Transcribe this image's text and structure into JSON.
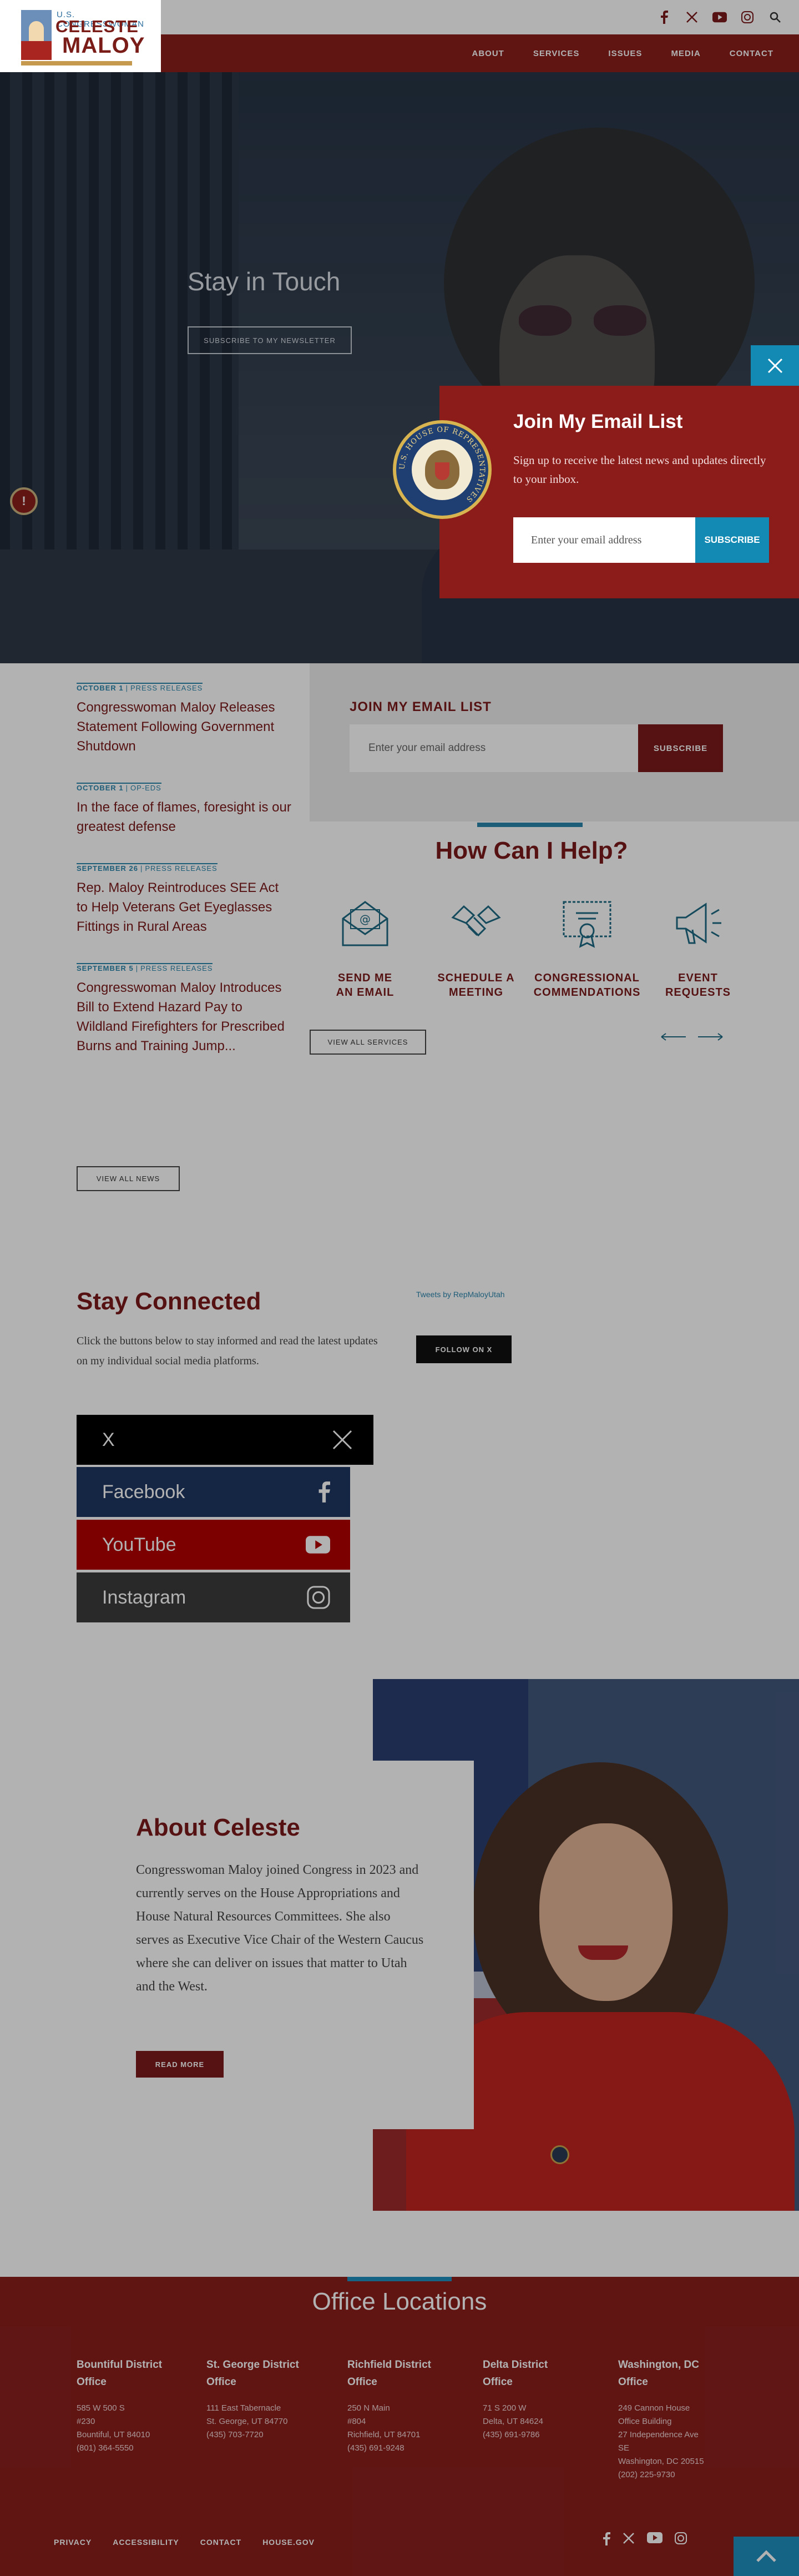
{
  "header": {
    "logo_top": "U.S. CONGRESSWOMAN",
    "logo_name_first": "CELESTE",
    "logo_name_last": "MALOY",
    "social": [
      "facebook-icon",
      "x-icon",
      "youtube-icon",
      "instagram-icon",
      "search-icon"
    ],
    "nav": [
      "ABOUT",
      "SERVICES",
      "ISSUES",
      "MEDIA",
      "CONTACT"
    ]
  },
  "hero": {
    "title": "Stay in Touch",
    "button": "SUBSCRIBE TO MY NEWSLETTER"
  },
  "popup": {
    "title": "Join My Email List",
    "subtitle": "Sign up to receive the latest news and updates directly to your inbox.",
    "input_placeholder": "Enter your email address",
    "button": "SUBSCRIBE",
    "seal_text": "U.S. HOUSE OF REPRESENTATIVES"
  },
  "news": {
    "items": [
      {
        "date": "OCTOBER 1",
        "category": "PRESS RELEASES",
        "title": "Congresswoman Maloy Releases Statement Following Government Shutdown"
      },
      {
        "date": "OCTOBER 1",
        "category": "OP-EDS",
        "title": "In the face of flames, foresight is our greatest defense"
      },
      {
        "date": "SEPTEMBER 26",
        "category": "PRESS RELEASES",
        "title": "Rep. Maloy Reintroduces SEE Act to Help Veterans Get Eyeglasses Fittings in Rural Areas"
      },
      {
        "date": "SEPTEMBER 5",
        "category": "PRESS RELEASES",
        "title": "Congresswoman Maloy Introduces Bill to Extend Hazard Pay to Wildland Firefighters for Prescribed Burns and Training Jump..."
      }
    ],
    "button": "VIEW ALL NEWS"
  },
  "signup": {
    "title": "JOIN MY EMAIL LIST",
    "input_placeholder": "Enter your email address",
    "button": "SUBSCRIBE"
  },
  "help": {
    "title": "How Can I Help?",
    "services": [
      {
        "label_line1": "SEND ME",
        "label_line2": "AN EMAIL",
        "icon": "envelope-icon"
      },
      {
        "label_line1": "SCHEDULE A",
        "label_line2": "MEETING",
        "icon": "handshake-icon"
      },
      {
        "label_line1": "CONGRESSIONAL",
        "label_line2": "COMMENDATIONS",
        "icon": "certificate-icon"
      },
      {
        "label_line1": "EVENT",
        "label_line2": "REQUESTS",
        "icon": "megaphone-icon"
      }
    ],
    "button": "VIEW ALL SERVICES"
  },
  "connect": {
    "title": "Stay Connected",
    "text": "Click the buttons below to stay informed and read the latest updates on my individual social media platforms.",
    "buttons": [
      {
        "label": "X",
        "color": "#000000"
      },
      {
        "label": "Facebook",
        "color": "#1f3764"
      },
      {
        "label": "YouTube",
        "color": "#b30000"
      },
      {
        "label": "Instagram",
        "color": "#3c3c3c"
      }
    ],
    "tweets_link": "Tweets by RepMaloyUtah",
    "follow_button": "FOLLOW ON X"
  },
  "about": {
    "title": "About Celeste",
    "text": "Congresswoman Maloy joined Congress in 2023 and currently serves on the House Appropriations and House Natural Resources Committees. She also serves as Executive Vice Chair of the Western Caucus where she can deliver on issues that matter to Utah and the West.",
    "button": "READ MORE"
  },
  "footer": {
    "title": "Office Locations",
    "offices": [
      {
        "name_1": "Bountiful District",
        "name_2": "Office",
        "lines": [
          "585 W 500 S",
          "#230",
          "Bountiful, UT 84010",
          "(801) 364-5550"
        ]
      },
      {
        "name_1": "St. George District",
        "name_2": "Office",
        "lines": [
          "111 East Tabernacle",
          "St. George, UT 84770",
          "(435) 703-7720"
        ]
      },
      {
        "name_1": "Richfield District",
        "name_2": "Office",
        "lines": [
          "250 N Main",
          "#804",
          "Richfield, UT 84701",
          "(435) 691-9248"
        ]
      },
      {
        "name_1": "Delta District",
        "name_2": "Office",
        "lines": [
          "71 S 200 W",
          "Delta, UT 84624",
          "(435) 691-9786"
        ]
      },
      {
        "name_1": "Washington, DC",
        "name_2": "Office",
        "lines": [
          "249 Cannon House",
          "Office Building",
          "27 Independence Ave",
          "SE",
          "Washington, DC 20515",
          "(202) 225-9730"
        ]
      }
    ],
    "links": [
      "PRIVACY",
      "ACCESSIBILITY",
      "CONTACT",
      "HOUSE.GOV"
    ]
  },
  "colors": {
    "maroon": "#7b1a1a",
    "nav_red": "#8a1f1c",
    "accent_blue": "#138ab3"
  }
}
